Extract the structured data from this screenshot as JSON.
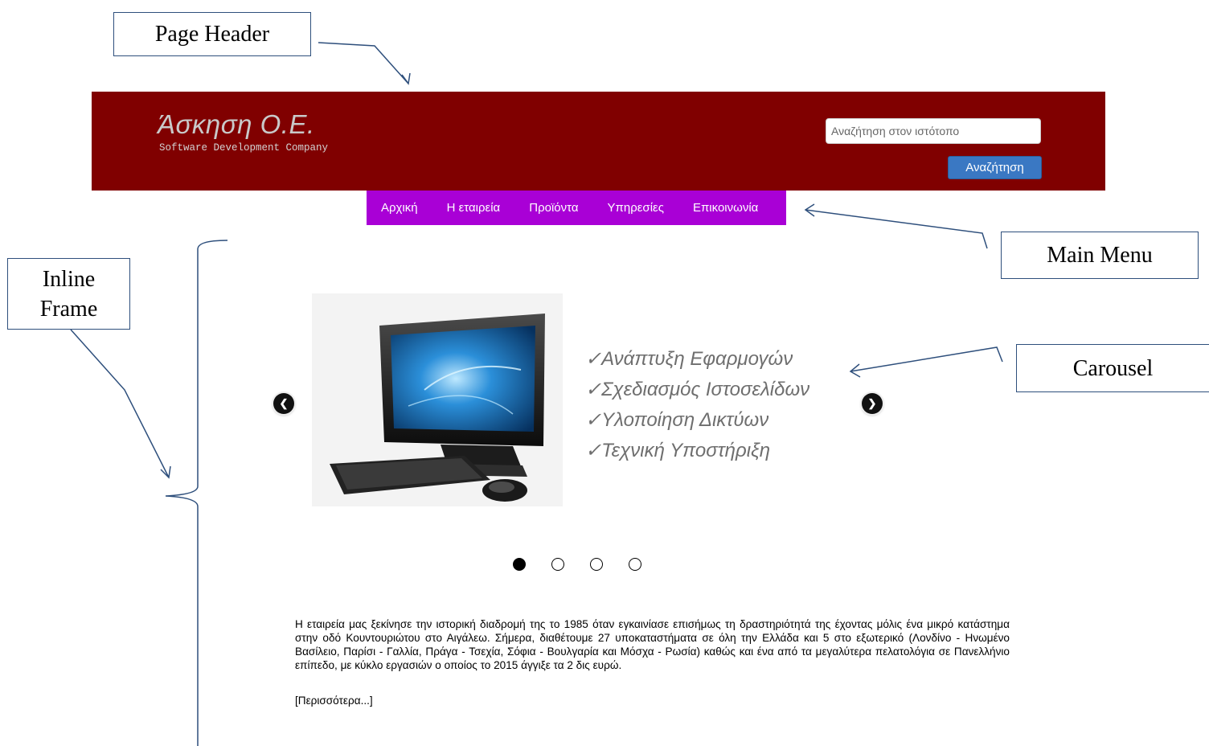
{
  "colors": {
    "header_bg": "#800000",
    "menu_bg": "#a900d6",
    "search_button_bg": "#3a78c3",
    "annotation_line": "#2e4f7c"
  },
  "annotations": {
    "page_header": "Page Header",
    "main_menu": "Main Menu",
    "inline_frame_line1": "Inline",
    "inline_frame_line2": "Frame",
    "carousel": "Carousel"
  },
  "header": {
    "title": "Άσκηση Ο.Ε.",
    "subtitle": "Software Development Company",
    "search_placeholder": "Αναζήτηση στον ιστότοπο",
    "search_button": "Αναζήτηση"
  },
  "menu": {
    "items": [
      "Αρχική",
      "Η εταιρεία",
      "Προϊόντα",
      "Υπηρεσίες",
      "Επικοινωνία"
    ]
  },
  "carousel": {
    "image_icon": "desktop-computer",
    "lines": [
      "✓Ανάπτυξη Εφαρμογών",
      "✓Σχεδιασμός Ιστοσελίδων",
      "✓Υλοποίηση Δικτύων",
      "✓Τεχνική Υποστήριξη"
    ],
    "prev_icon": "chevron-left",
    "next_icon": "chevron-right",
    "slide_count": 4,
    "active_index": 0
  },
  "content": {
    "paragraph": "Η εταιρεία μας ξεκίνησε την ιστορική διαδρομή της το 1985 όταν εγκαινίασε επισήμως τη δραστηριότητά της έχοντας μόλις ένα μικρό κατάστημα στην οδό Κουντουριώτου στο Αιγάλεω. Σήμερα, διαθέτουμε 27 υποκαταστήματα σε όλη την Ελλάδα και 5 στο εξωτερικό (Λονδίνο - Ηνωμένο Βασίλειο, Παρίσι - Γαλλία, Πράγα - Τσεχία, Σόφια - Βουλγαρία και Μόσχα - Ρωσία) καθώς και ένα από τα μεγαλύτερα πελατολόγια σε Πανελλήνιο επίπεδο, με κύκλο εργασιών ο οποίος το 2015 άγγιξε τα 2 δις ευρώ.",
    "more_link": "[Περισσότερα...]"
  }
}
